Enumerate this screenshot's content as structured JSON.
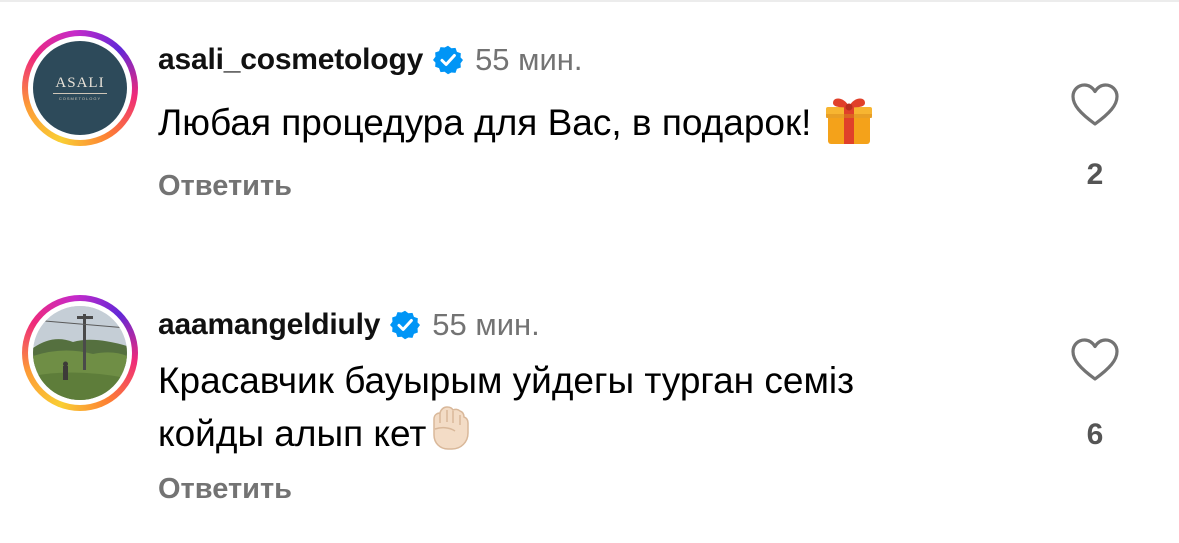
{
  "comments": [
    {
      "username": "asali_cosmetology",
      "time": "55 мин.",
      "text": "Любая процедура для Вас, в подарок!",
      "reply_label": "Ответить",
      "likes": "2",
      "avatar_logo": "ASALI",
      "avatar_sub": "COSMETOLOGY",
      "emoji": "gift-emoji"
    },
    {
      "username": "aaamangeldiuly",
      "time": "55 мин.",
      "text_line1": "Красавчик бауырым уйдегы турган семіз",
      "text_line2": "койды алып кет",
      "reply_label": "Ответить",
      "likes": "6",
      "emoji": "raised-fist-emoji"
    }
  ],
  "colors": {
    "verified": "#0095f6",
    "secondary_text": "#737373",
    "like_count": "#555555"
  }
}
